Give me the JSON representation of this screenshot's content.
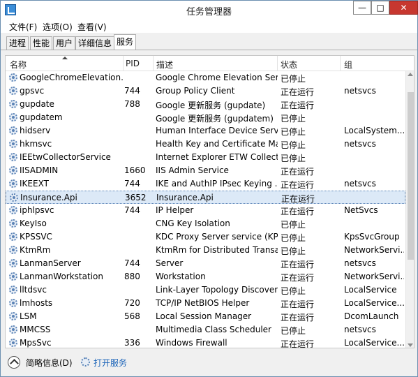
{
  "window": {
    "title": "任务管理器",
    "minimize": "—",
    "maximize": "□",
    "close": "✕"
  },
  "menu": [
    "文件(F)",
    "选项(O)",
    "查看(V)"
  ],
  "tabs": [
    "进程",
    "性能",
    "用户",
    "详细信息",
    "服务"
  ],
  "active_tab": "服务",
  "columns": {
    "name": "名称",
    "pid": "PID",
    "desc": "描述",
    "status": "状态",
    "group": "组"
  },
  "rows": [
    {
      "name": "GoogleChromeElevation...",
      "pid": "",
      "desc": "Google Chrome Elevation Ser...",
      "status": "已停止",
      "group": ""
    },
    {
      "name": "gpsvc",
      "pid": "744",
      "desc": "Group Policy Client",
      "status": "正在运行",
      "group": "netsvcs"
    },
    {
      "name": "gupdate",
      "pid": "788",
      "desc": "Google 更新服务 (gupdate)",
      "status": "正在运行",
      "group": ""
    },
    {
      "name": "gupdatem",
      "pid": "",
      "desc": "Google 更新服务 (gupdatem)",
      "status": "已停止",
      "group": ""
    },
    {
      "name": "hidserv",
      "pid": "",
      "desc": "Human Interface Device Service",
      "status": "已停止",
      "group": "LocalSystem..."
    },
    {
      "name": "hkmsvc",
      "pid": "",
      "desc": "Health Key and Certificate Ma...",
      "status": "已停止",
      "group": "netsvcs"
    },
    {
      "name": "IEEtwCollectorService",
      "pid": "",
      "desc": "Internet Explorer ETW Collect...",
      "status": "已停止",
      "group": ""
    },
    {
      "name": "IISADMIN",
      "pid": "1660",
      "desc": "IIS Admin Service",
      "status": "正在运行",
      "group": ""
    },
    {
      "name": "IKEEXT",
      "pid": "744",
      "desc": "IKE and AuthIP IPsec Keying ...",
      "status": "正在运行",
      "group": "netsvcs"
    },
    {
      "name": "Insurance.Api",
      "pid": "3652",
      "desc": "Insurance.Api",
      "status": "正在运行",
      "group": ""
    },
    {
      "name": "iphlpsvc",
      "pid": "744",
      "desc": "IP Helper",
      "status": "正在运行",
      "group": "NetSvcs"
    },
    {
      "name": "KeyIso",
      "pid": "",
      "desc": "CNG Key Isolation",
      "status": "已停止",
      "group": ""
    },
    {
      "name": "KPSSVC",
      "pid": "",
      "desc": "KDC Proxy Server service (KPS)",
      "status": "已停止",
      "group": "KpsSvcGroup"
    },
    {
      "name": "KtmRm",
      "pid": "",
      "desc": "KtmRm for Distributed Transa...",
      "status": "已停止",
      "group": "NetworkServi..."
    },
    {
      "name": "LanmanServer",
      "pid": "744",
      "desc": "Server",
      "status": "正在运行",
      "group": "netsvcs"
    },
    {
      "name": "LanmanWorkstation",
      "pid": "880",
      "desc": "Workstation",
      "status": "正在运行",
      "group": "NetworkServi..."
    },
    {
      "name": "lltdsvc",
      "pid": "",
      "desc": "Link-Layer Topology Discover...",
      "status": "已停止",
      "group": "LocalService"
    },
    {
      "name": "lmhosts",
      "pid": "720",
      "desc": "TCP/IP NetBIOS Helper",
      "status": "正在运行",
      "group": "LocalService..."
    },
    {
      "name": "LSM",
      "pid": "568",
      "desc": "Local Session Manager",
      "status": "正在运行",
      "group": "DcomLaunch"
    },
    {
      "name": "MMCSS",
      "pid": "",
      "desc": "Multimedia Class Scheduler",
      "status": "已停止",
      "group": "netsvcs"
    },
    {
      "name": "MpsSvc",
      "pid": "336",
      "desc": "Windows Firewall",
      "status": "正在运行",
      "group": "LocalService..."
    }
  ],
  "selected_index": 9,
  "footer": {
    "fewer_details": "简略信息(D)",
    "open_services": "打开服务"
  }
}
